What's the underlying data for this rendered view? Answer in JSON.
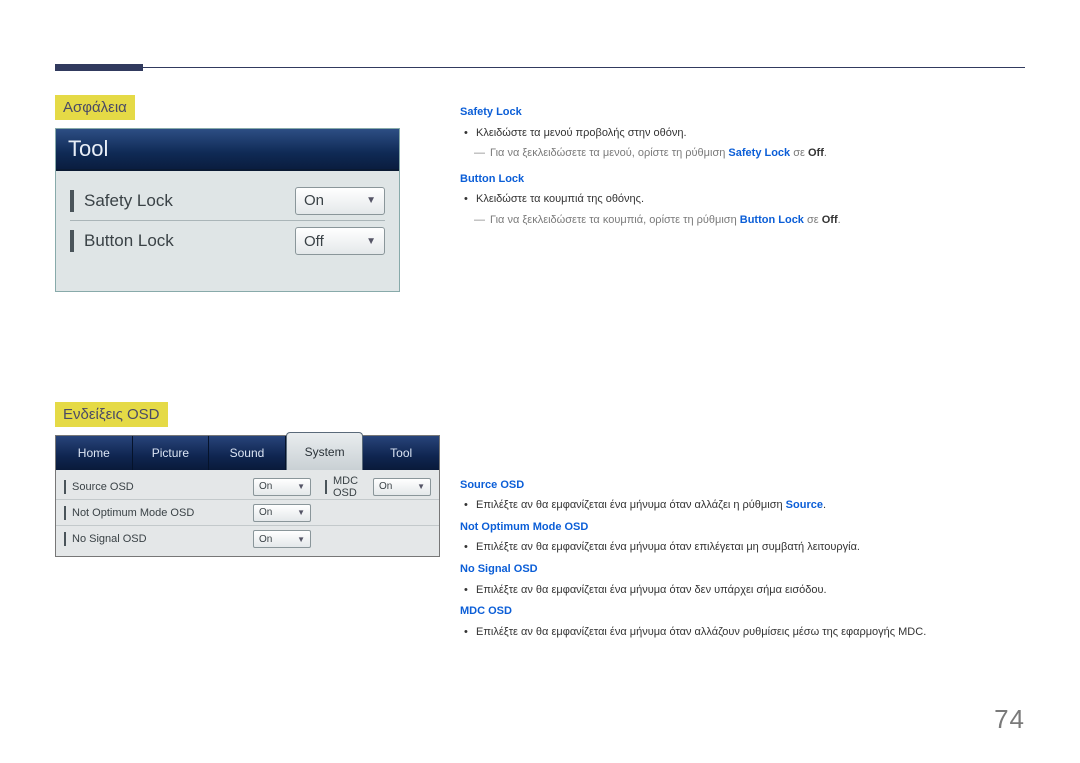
{
  "page_number": "74",
  "section1_heading": "Ασφάλεια",
  "section2_heading": "Ενδείξεις OSD",
  "tool_panel": {
    "title": "Tool",
    "rows": [
      {
        "label": "Safety Lock",
        "value": "On"
      },
      {
        "label": "Button Lock",
        "value": "Off"
      }
    ]
  },
  "system_panel": {
    "tabs": [
      "Home",
      "Picture",
      "Sound",
      "System",
      "Tool"
    ],
    "active_tab": "System",
    "rows_left": [
      {
        "label": "Source OSD",
        "value": "On"
      },
      {
        "label": "Not Optimum Mode OSD",
        "value": "On"
      },
      {
        "label": "No Signal OSD",
        "value": "On"
      }
    ],
    "rows_right": [
      {
        "label": "MDC OSD",
        "value": "On"
      }
    ]
  },
  "section1_text": {
    "f1_title": "Safety Lock",
    "f1_bullet": "Κλειδώστε τα μενού προβολής στην οθόνη.",
    "f1_dash_pre": "Για να ξεκλειδώσετε τα μενού, ορίστε τη ρύθμιση ",
    "f1_dash_em": "Safety Lock",
    "f1_dash_mid": " σε ",
    "f1_dash_off": "Off",
    "f1_dash_end": ".",
    "f2_title": "Button Lock",
    "f2_bullet": "Κλειδώστε τα κουμπιά της οθόνης.",
    "f2_dash_pre": "Για να ξεκλειδώσετε τα κουμπιά, ορίστε τη ρύθμιση ",
    "f2_dash_em": "Button Lock",
    "f2_dash_mid": " σε ",
    "f2_dash_off": "Off",
    "f2_dash_end": "."
  },
  "section2_text": {
    "f1_title": "Source OSD",
    "f1_bullet_pre": "Επιλέξτε αν θα εμφανίζεται ένα μήνυμα όταν αλλάζει η ρύθμιση ",
    "f1_bullet_em": "Source",
    "f1_bullet_end": ".",
    "f2_title": "Not Optimum Mode OSD",
    "f2_bullet": "Επιλέξτε αν θα εμφανίζεται ένα μήνυμα όταν επιλέγεται μη συμβατή λειτουργία.",
    "f3_title": "No Signal OSD",
    "f3_bullet": "Επιλέξτε αν θα εμφανίζεται ένα μήνυμα όταν δεν υπάρχει σήμα εισόδου.",
    "f4_title": "MDC OSD",
    "f4_bullet": "Επιλέξτε αν θα εμφανίζεται ένα μήνυμα όταν αλλάζουν ρυθμίσεις μέσω της εφαρμογής MDC."
  }
}
